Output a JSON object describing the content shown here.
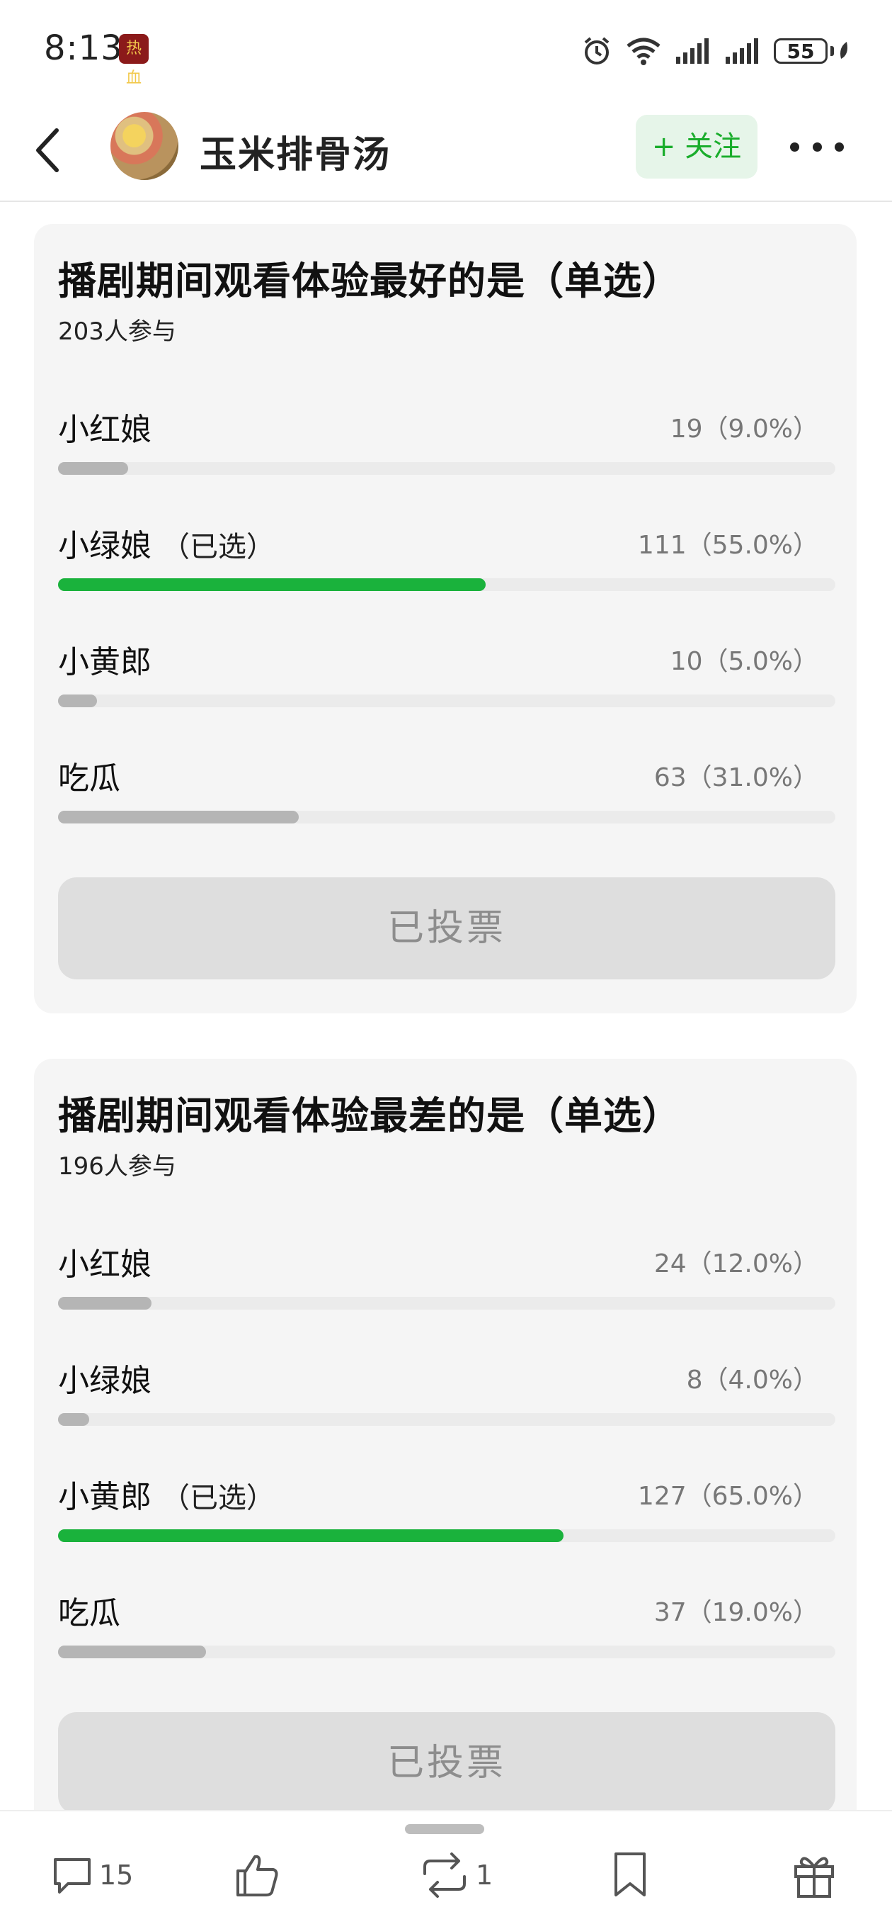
{
  "status_bar": {
    "time": "8:13",
    "app_badge": "热血",
    "battery": "55"
  },
  "header": {
    "account_name": "玉米排骨汤",
    "follow_label": "+ 关注"
  },
  "polls": [
    {
      "title": "播剧期间观看体验最好的是（单选）",
      "participants": "203人参与",
      "options": [
        {
          "label": "小红娘",
          "selected_tag": "",
          "result": "19（9.0%）",
          "fraction": 0.09,
          "selected": false
        },
        {
          "label": "小绿娘",
          "selected_tag": "（已选）",
          "result": "111（55.0%）",
          "fraction": 0.55,
          "selected": true
        },
        {
          "label": "小黄郎",
          "selected_tag": "",
          "result": "10（5.0%）",
          "fraction": 0.05,
          "selected": false
        },
        {
          "label": "吃瓜",
          "selected_tag": "",
          "result": "63（31.0%）",
          "fraction": 0.31,
          "selected": false
        }
      ],
      "voted_label": "已投票"
    },
    {
      "title": "播剧期间观看体验最差的是（单选）",
      "participants": "196人参与",
      "options": [
        {
          "label": "小红娘",
          "selected_tag": "",
          "result": "24（12.0%）",
          "fraction": 0.12,
          "selected": false
        },
        {
          "label": "小绿娘",
          "selected_tag": "",
          "result": "8（4.0%）",
          "fraction": 0.04,
          "selected": false
        },
        {
          "label": "小黄郎",
          "selected_tag": "（已选）",
          "result": "127（65.0%）",
          "fraction": 0.65,
          "selected": true
        },
        {
          "label": "吃瓜",
          "selected_tag": "",
          "result": "37（19.0%）",
          "fraction": 0.19,
          "selected": false
        }
      ],
      "voted_label": "已投票"
    }
  ],
  "bottom_bar": {
    "comment_count": "15",
    "repost_count": "1"
  },
  "colors": {
    "accent_green": "#1ab23c",
    "bar_gray": "#b5b5b5",
    "follow_bg": "#e6f5e9"
  },
  "icons": [
    "back-icon",
    "alarm-icon",
    "wifi-icon",
    "signal-icon",
    "battery-icon",
    "comment-icon",
    "like-icon",
    "repost-icon",
    "bookmark-icon",
    "gift-icon",
    "more-icon"
  ]
}
